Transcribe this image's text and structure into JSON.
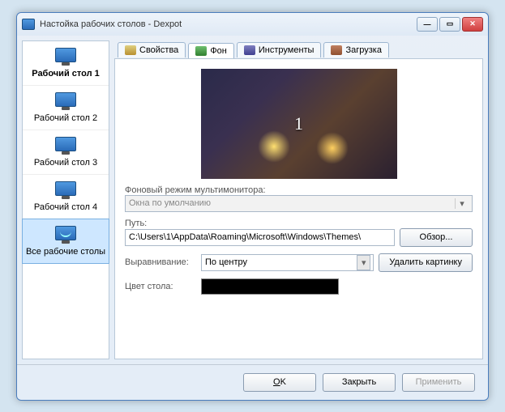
{
  "window": {
    "title": "Настойка рабочих столов - Dexpot"
  },
  "sidebar": {
    "items": [
      {
        "label": "Рабочий стол 1"
      },
      {
        "label": "Рабочий стол 2"
      },
      {
        "label": "Рабочий стол 3"
      },
      {
        "label": "Рабочий стол 4"
      },
      {
        "label": "Все рабочие столы"
      }
    ]
  },
  "tabs": {
    "properties": "Свойства",
    "background": "Фон",
    "tools": "Инструменты",
    "startup": "Загрузка"
  },
  "preview": {
    "number": "1"
  },
  "form": {
    "multimonitor_label": "Фоновый режим мультимонитора:",
    "multimonitor_value": "Окна по умолчанию",
    "path_label": "Путь:",
    "path_value": "C:\\Users\\1\\AppData\\Roaming\\Microsoft\\Windows\\Themes\\",
    "browse": "Обзор...",
    "alignment_label": "Выравнивание:",
    "alignment_value": "По центру",
    "delete_picture": "Удалить картинку",
    "desk_color_label": "Цвет стола:",
    "desk_color_value": "#000000"
  },
  "buttons": {
    "ok": "OK",
    "close": "Закрыть",
    "apply": "Применить"
  }
}
